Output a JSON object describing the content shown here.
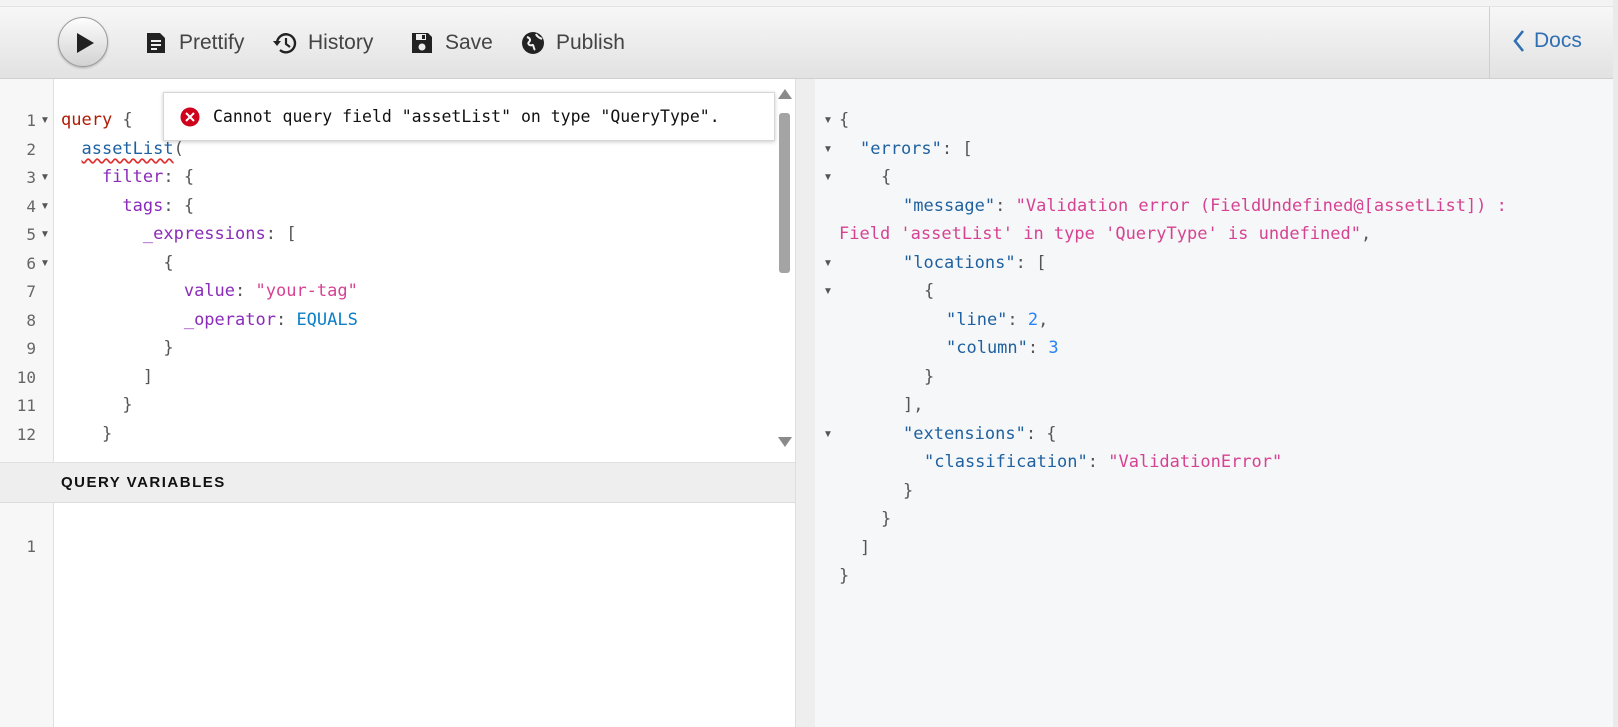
{
  "toolbar": {
    "run_label": "Run",
    "prettify_label": "Prettify",
    "history_label": "History",
    "save_label": "Save",
    "publish_label": "Publish",
    "docs_label": "Docs"
  },
  "query_editor": {
    "line_numbers": [
      "1",
      "2",
      "3",
      "4",
      "5",
      "6",
      "7",
      "8",
      "9",
      "10",
      "11",
      "12"
    ],
    "lines": {
      "l1_kw": "query",
      "l1_p": " {",
      "l2_field": "assetList",
      "l2_p": "(",
      "l3_attr": "filter",
      "l3_p": ": {",
      "l4_attr": "tags",
      "l4_p": ": {",
      "l5_attr": "_expressions",
      "l5_p": ": [",
      "l6_p": "{",
      "l7_attr": "value",
      "l7_p": ": ",
      "l7_str": "\"your-tag\"",
      "l8_attr": "_operator",
      "l8_p": ": ",
      "l8_enum": "EQUALS",
      "l9_p": "}",
      "l10_p": "]",
      "l11_p": "}",
      "l12_p": "}"
    },
    "error_tooltip": "Cannot query field \"assetList\" on type \"QueryType\"."
  },
  "variables": {
    "header": "QUERY VARIABLES",
    "line_numbers": [
      "1"
    ]
  },
  "result": {
    "r1": "{",
    "r2_key": "\"errors\"",
    "r2_p": ": [",
    "r3": "{",
    "r4_key": "\"message\"",
    "r4_p": ": ",
    "r4_str": "\"Validation error (FieldUndefined@[assetList]) :",
    "r5_str": "Field 'assetList' in type 'QueryType' is undefined\"",
    "r5_p": ",",
    "r6_key": "\"locations\"",
    "r6_p": ": [",
    "r7": "{",
    "r8_key": "\"line\"",
    "r8_p": ": ",
    "r8_num": "2",
    "r8_p2": ",",
    "r9_key": "\"column\"",
    "r9_p": ": ",
    "r9_num": "3",
    "r10": "}",
    "r11": "],",
    "r12_key": "\"extensions\"",
    "r12_p": ": {",
    "r13_key": "\"classification\"",
    "r13_p": ": ",
    "r13_str": "\"ValidationError\"",
    "r14": "}",
    "r15": "}",
    "r16": "]",
    "r17": "}"
  },
  "colors": {
    "keyword": "#b11a04",
    "field": "#1f61a0",
    "attribute": "#8b2bb9",
    "string": "#d64292",
    "enum": "#0b7fc7",
    "number": "#2882f9",
    "docs_link": "#2f6fb3",
    "error_icon": "#d0021b"
  }
}
